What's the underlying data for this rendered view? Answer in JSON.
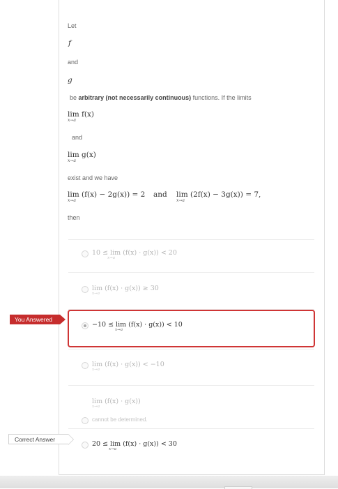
{
  "question": {
    "let": "Let",
    "f": "f",
    "and1": "and",
    "g": "g",
    "be_pre": "be",
    "be_bold": "arbitrary (not necessarily continuous)",
    "be_post": "functions. If the limits",
    "lim_f": "lim f(x)",
    "and2": "and",
    "lim_g": "lim g(x)",
    "exist": "exist and we have",
    "eq1": "lim (f(x) − 2g(x)) = 2",
    "and3": "and",
    "eq2": "lim (2f(x) − 3g(x)) = 7,",
    "then": "then",
    "sub": "x→a"
  },
  "options": [
    {
      "text": "10 ≤ lim (f(x) · g(x)) < 20",
      "selected": false
    },
    {
      "text": "lim (f(x) · g(x)) ≥ 30",
      "selected": false
    },
    {
      "text": "−10 ≤ lim (f(x) · g(x)) < 10",
      "selected": true
    },
    {
      "text": "lim (f(x) · g(x)) < −10",
      "selected": false
    },
    {
      "text": "lim (f(x) · g(x))",
      "subtext": "cannot be determined.",
      "selected": false
    },
    {
      "text": "20 ≤ lim (f(x) · g(x)) < 30",
      "selected": false
    }
  ],
  "labels": {
    "you_answered": "You Answered",
    "correct_answer": "Correct Answer"
  },
  "colors": {
    "answered_red": "#c62d2d",
    "border_gray": "#dcdcdc"
  }
}
